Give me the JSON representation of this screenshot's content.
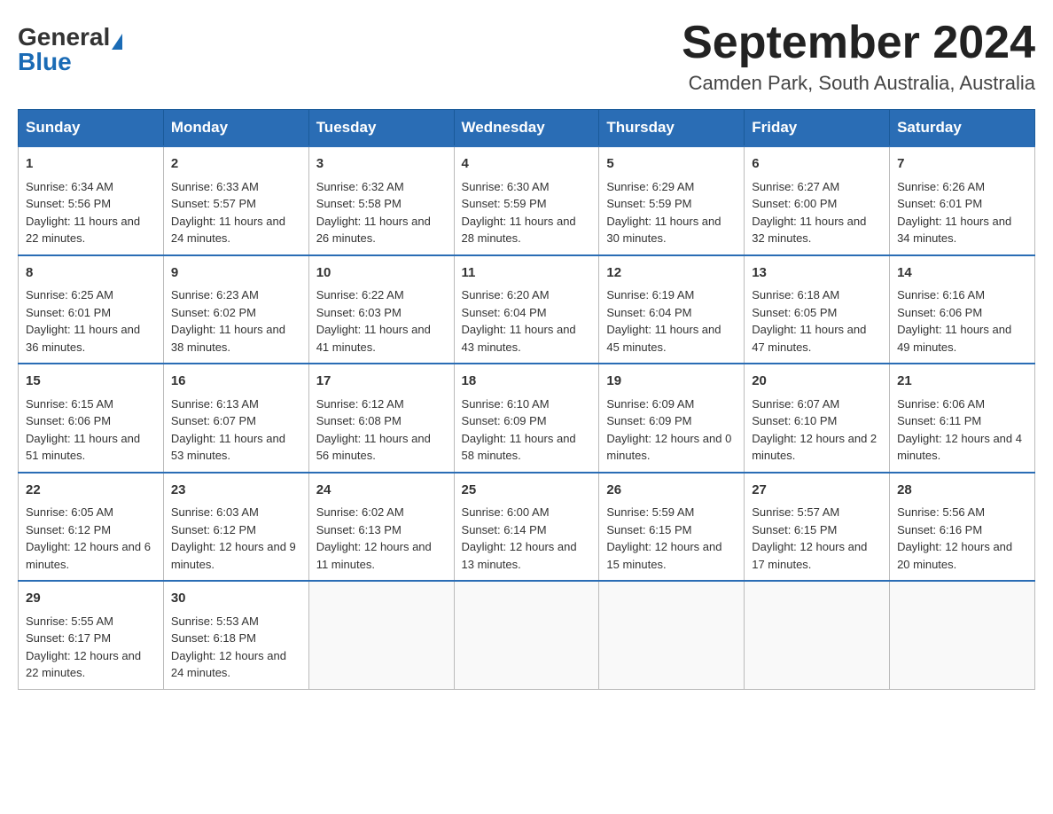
{
  "header": {
    "logo_general": "General",
    "logo_blue": "Blue",
    "month_year": "September 2024",
    "location": "Camden Park, South Australia, Australia"
  },
  "days_of_week": [
    "Sunday",
    "Monday",
    "Tuesday",
    "Wednesday",
    "Thursday",
    "Friday",
    "Saturday"
  ],
  "weeks": [
    [
      {
        "day": "1",
        "sunrise": "6:34 AM",
        "sunset": "5:56 PM",
        "daylight": "11 hours and 22 minutes."
      },
      {
        "day": "2",
        "sunrise": "6:33 AM",
        "sunset": "5:57 PM",
        "daylight": "11 hours and 24 minutes."
      },
      {
        "day": "3",
        "sunrise": "6:32 AM",
        "sunset": "5:58 PM",
        "daylight": "11 hours and 26 minutes."
      },
      {
        "day": "4",
        "sunrise": "6:30 AM",
        "sunset": "5:59 PM",
        "daylight": "11 hours and 28 minutes."
      },
      {
        "day": "5",
        "sunrise": "6:29 AM",
        "sunset": "5:59 PM",
        "daylight": "11 hours and 30 minutes."
      },
      {
        "day": "6",
        "sunrise": "6:27 AM",
        "sunset": "6:00 PM",
        "daylight": "11 hours and 32 minutes."
      },
      {
        "day": "7",
        "sunrise": "6:26 AM",
        "sunset": "6:01 PM",
        "daylight": "11 hours and 34 minutes."
      }
    ],
    [
      {
        "day": "8",
        "sunrise": "6:25 AM",
        "sunset": "6:01 PM",
        "daylight": "11 hours and 36 minutes."
      },
      {
        "day": "9",
        "sunrise": "6:23 AM",
        "sunset": "6:02 PM",
        "daylight": "11 hours and 38 minutes."
      },
      {
        "day": "10",
        "sunrise": "6:22 AM",
        "sunset": "6:03 PM",
        "daylight": "11 hours and 41 minutes."
      },
      {
        "day": "11",
        "sunrise": "6:20 AM",
        "sunset": "6:04 PM",
        "daylight": "11 hours and 43 minutes."
      },
      {
        "day": "12",
        "sunrise": "6:19 AM",
        "sunset": "6:04 PM",
        "daylight": "11 hours and 45 minutes."
      },
      {
        "day": "13",
        "sunrise": "6:18 AM",
        "sunset": "6:05 PM",
        "daylight": "11 hours and 47 minutes."
      },
      {
        "day": "14",
        "sunrise": "6:16 AM",
        "sunset": "6:06 PM",
        "daylight": "11 hours and 49 minutes."
      }
    ],
    [
      {
        "day": "15",
        "sunrise": "6:15 AM",
        "sunset": "6:06 PM",
        "daylight": "11 hours and 51 minutes."
      },
      {
        "day": "16",
        "sunrise": "6:13 AM",
        "sunset": "6:07 PM",
        "daylight": "11 hours and 53 minutes."
      },
      {
        "day": "17",
        "sunrise": "6:12 AM",
        "sunset": "6:08 PM",
        "daylight": "11 hours and 56 minutes."
      },
      {
        "day": "18",
        "sunrise": "6:10 AM",
        "sunset": "6:09 PM",
        "daylight": "11 hours and 58 minutes."
      },
      {
        "day": "19",
        "sunrise": "6:09 AM",
        "sunset": "6:09 PM",
        "daylight": "12 hours and 0 minutes."
      },
      {
        "day": "20",
        "sunrise": "6:07 AM",
        "sunset": "6:10 PM",
        "daylight": "12 hours and 2 minutes."
      },
      {
        "day": "21",
        "sunrise": "6:06 AM",
        "sunset": "6:11 PM",
        "daylight": "12 hours and 4 minutes."
      }
    ],
    [
      {
        "day": "22",
        "sunrise": "6:05 AM",
        "sunset": "6:12 PM",
        "daylight": "12 hours and 6 minutes."
      },
      {
        "day": "23",
        "sunrise": "6:03 AM",
        "sunset": "6:12 PM",
        "daylight": "12 hours and 9 minutes."
      },
      {
        "day": "24",
        "sunrise": "6:02 AM",
        "sunset": "6:13 PM",
        "daylight": "12 hours and 11 minutes."
      },
      {
        "day": "25",
        "sunrise": "6:00 AM",
        "sunset": "6:14 PM",
        "daylight": "12 hours and 13 minutes."
      },
      {
        "day": "26",
        "sunrise": "5:59 AM",
        "sunset": "6:15 PM",
        "daylight": "12 hours and 15 minutes."
      },
      {
        "day": "27",
        "sunrise": "5:57 AM",
        "sunset": "6:15 PM",
        "daylight": "12 hours and 17 minutes."
      },
      {
        "day": "28",
        "sunrise": "5:56 AM",
        "sunset": "6:16 PM",
        "daylight": "12 hours and 20 minutes."
      }
    ],
    [
      {
        "day": "29",
        "sunrise": "5:55 AM",
        "sunset": "6:17 PM",
        "daylight": "12 hours and 22 minutes."
      },
      {
        "day": "30",
        "sunrise": "5:53 AM",
        "sunset": "6:18 PM",
        "daylight": "12 hours and 24 minutes."
      },
      null,
      null,
      null,
      null,
      null
    ]
  ]
}
